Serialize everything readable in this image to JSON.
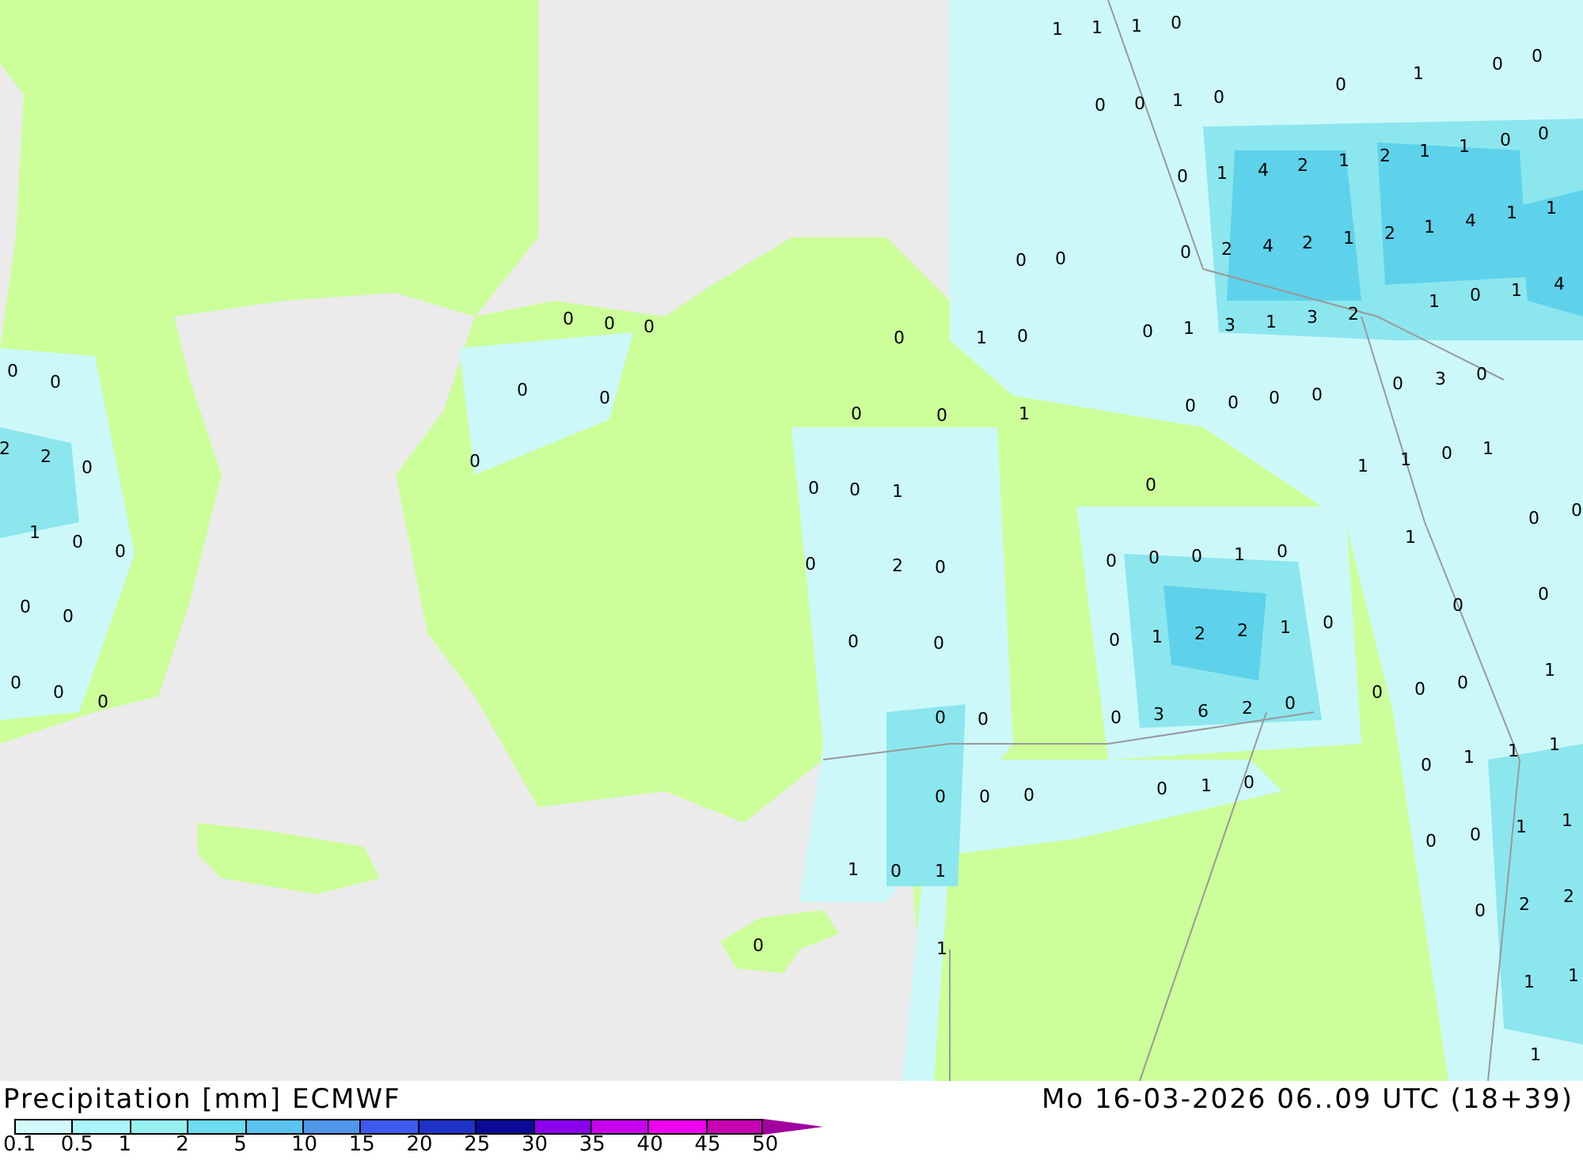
{
  "map": {
    "labels": [
      "1",
      "1",
      "1",
      "0",
      "0",
      "0",
      "1",
      "0",
      "0",
      "1",
      "0",
      "0",
      "0",
      "1",
      "4",
      "2",
      "1",
      "2",
      "1",
      "1",
      "0",
      "0",
      "0",
      "0",
      "0",
      "2",
      "4",
      "2",
      "1",
      "2",
      "1",
      "4",
      "1",
      "1",
      "0",
      "0",
      "0",
      "0",
      "1",
      "0",
      "0",
      "1",
      "3",
      "1",
      "3",
      "2",
      "1",
      "0",
      "1",
      "4",
      "0",
      "0",
      "0",
      "0",
      "0",
      "0",
      "1",
      "0",
      "0",
      "0",
      "0",
      "0",
      "3",
      "0",
      "2",
      "2",
      "0",
      "0",
      "0",
      "0",
      "1",
      "0",
      "1",
      "1",
      "0",
      "1",
      "1",
      "0",
      "0",
      "0",
      "2",
      "0",
      "0",
      "0",
      "0",
      "1",
      "0",
      "1",
      "0",
      "0",
      "0",
      "0",
      "0",
      "0",
      "0",
      "1",
      "2",
      "2",
      "1",
      "0",
      "0",
      "0",
      "0",
      "0",
      "0",
      "0",
      "0",
      "0",
      "3",
      "6",
      "2",
      "0",
      "0",
      "0",
      "0",
      "1",
      "0",
      "0",
      "0",
      "0",
      "1",
      "0",
      "0",
      "1",
      "1",
      "1",
      "1",
      "0",
      "1",
      "0",
      "0",
      "1",
      "1",
      "0",
      "2",
      "2",
      "0",
      "1",
      "1",
      "1",
      "1"
    ]
  },
  "footer": {
    "title": "Precipitation [mm] ECMWF",
    "datetime": "Mo 16-03-2026 06..09 UTC (18+39)",
    "legend_colors": [
      {
        "color": "#d2fafa",
        "kind": "swatch"
      },
      {
        "color": "#aaf5fa",
        "kind": "swatch"
      },
      {
        "color": "#96f0f0",
        "kind": "swatch"
      },
      {
        "color": "#6edcf0",
        "kind": "swatch"
      },
      {
        "color": "#5ac3f0",
        "kind": "swatch"
      },
      {
        "color": "#5096eb",
        "kind": "swatch"
      },
      {
        "color": "#3c5af0",
        "kind": "swatch"
      },
      {
        "color": "#1e32c8",
        "kind": "swatch"
      },
      {
        "color": "#0a0a96",
        "kind": "swatch"
      },
      {
        "color": "#8c00f0",
        "kind": "swatch"
      },
      {
        "color": "#c800f0",
        "kind": "swatch"
      },
      {
        "color": "#f000f0",
        "kind": "swatch"
      },
      {
        "color": "#c800b4",
        "kind": "swatch"
      },
      {
        "color": "#a000a0",
        "kind": "arrow"
      }
    ],
    "legend_ticks": [
      "0.1",
      "0.5",
      "1",
      "2",
      "5",
      "10",
      "15",
      "20",
      "25",
      "30",
      "35",
      "40",
      "45",
      "50"
    ]
  }
}
